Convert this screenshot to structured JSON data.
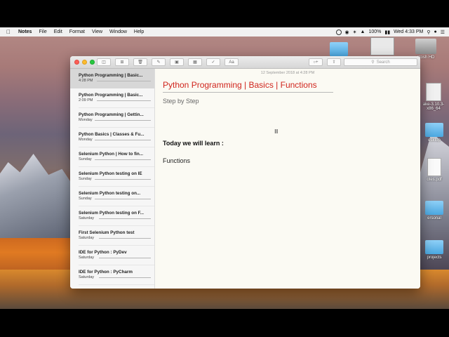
{
  "menubar": {
    "app": "Notes",
    "menus": [
      "File",
      "Edit",
      "Format",
      "View",
      "Window",
      "Help"
    ],
    "battery": "100%",
    "clock": "Wed 4:33 PM"
  },
  "desktop": {
    "icons": [
      {
        "label": "ntosh HD"
      },
      {
        "label": "ake-3.10.3-x86_64"
      },
      {
        "label": "esktop"
      },
      {
        "label": "otes.pdf"
      },
      {
        "label": "ersonal"
      },
      {
        "label": "projects"
      }
    ]
  },
  "toolbar": {
    "search_placeholder": "Search",
    "format_label": "Aa"
  },
  "notes_list": [
    {
      "title": "Python Programming | Basic...",
      "date": "4:28 PM",
      "selected": true
    },
    {
      "title": "Python Programming | Basic...",
      "date": "2:09 PM"
    },
    {
      "title": "Python Programming | Gettin...",
      "date": "Monday"
    },
    {
      "title": "Python Basics | Classes & Fu...",
      "date": "Monday"
    },
    {
      "title": "Selenium Python | How to fin...",
      "date": "Sunday"
    },
    {
      "title": "Selenium Python testing on IE",
      "date": "Sunday"
    },
    {
      "title": "Selenium Python testing on...",
      "date": "Sunday"
    },
    {
      "title": "Selenium Python testing on F...",
      "date": "Saturday"
    },
    {
      "title": "First Selenium Python test",
      "date": "Saturday"
    },
    {
      "title": "IDE for Python : PyDev",
      "date": "Saturday"
    },
    {
      "title": "IDE for Python : PyCharm",
      "date": "Saturday"
    }
  ],
  "note": {
    "date": "12 September 2018 at 4:28 PM",
    "title": "Python Programming | Basics | Functions",
    "subtitle": "Step by Step",
    "heading": "Today we will learn :",
    "body": "Functions"
  }
}
